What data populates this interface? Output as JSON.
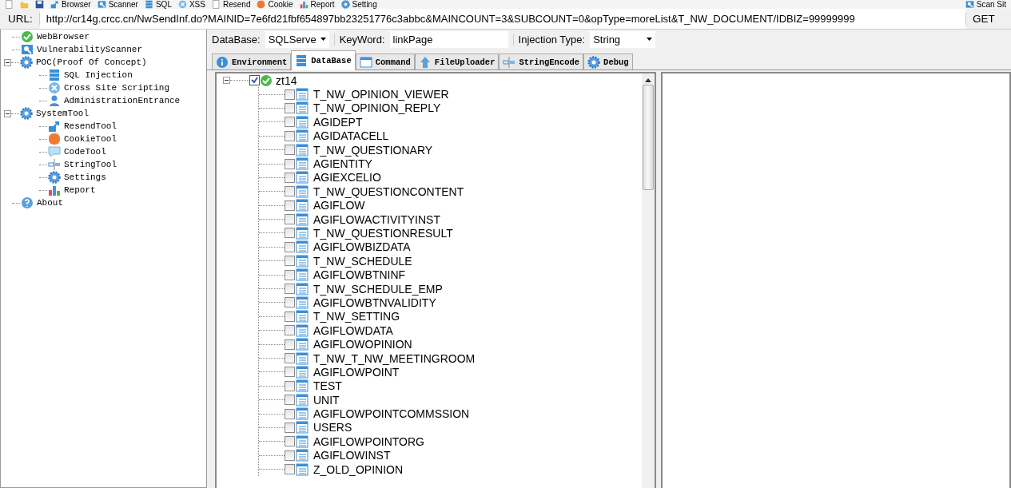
{
  "toolbar": {
    "items": [
      {
        "label": "Browser"
      },
      {
        "label": "Scanner"
      },
      {
        "label": "SQL"
      },
      {
        "label": "XSS"
      },
      {
        "label": "Resend"
      },
      {
        "label": "Cookie"
      },
      {
        "label": "Report"
      },
      {
        "label": "Setting"
      }
    ],
    "right_item": "Scan Sit"
  },
  "url_bar": {
    "label": "URL:",
    "value": "http://cr14g.crcc.cn/NwSendInf.do?MAINID=7e6fd21fbf654897bb23251776c3abbc&MAINCOUNT=3&SUBCOUNT=0&opType=moreList&T_NW_DOCUMENT/IDBIZ=99999999",
    "method": "GET"
  },
  "sidebar": {
    "items": [
      {
        "label": "WebBrowser"
      },
      {
        "label": "VulnerabilityScanner"
      },
      {
        "label": "POC(Proof Of Concept)",
        "expanded": true,
        "children": [
          {
            "label": "SQL Injection"
          },
          {
            "label": "Cross Site Scripting"
          },
          {
            "label": "AdministrationEntrance"
          }
        ]
      },
      {
        "label": "SystemTool",
        "expanded": true,
        "children": [
          {
            "label": "ResendTool"
          },
          {
            "label": "CookieTool"
          },
          {
            "label": "CodeTool"
          },
          {
            "label": "StringTool"
          },
          {
            "label": "Settings"
          },
          {
            "label": "Report"
          }
        ]
      },
      {
        "label": "About"
      }
    ]
  },
  "options": {
    "database_label": "DataBase:",
    "database": "SQLServe",
    "keyword_label": "KeyWord:",
    "keyword": "linkPage",
    "injection_label": "Injection Type:",
    "injection_type": "String"
  },
  "tabs": [
    {
      "label": "Environment",
      "selected": false
    },
    {
      "label": "DataBase",
      "selected": true
    },
    {
      "label": "Command",
      "selected": false
    },
    {
      "label": "FileUploader",
      "selected": false
    },
    {
      "label": "StringEncode",
      "selected": false
    },
    {
      "label": "Debug",
      "selected": false
    }
  ],
  "db_tree": {
    "label": "zt14",
    "checked": true,
    "expanded": true,
    "children": [
      {
        "label": "T_NW_OPINION_VIEWER",
        "checked": false
      },
      {
        "label": "T_NW_OPINION_REPLY",
        "checked": false
      },
      {
        "label": "AGIDEPT",
        "checked": false
      },
      {
        "label": "AGIDATACELL",
        "checked": false
      },
      {
        "label": "T_NW_QUESTIONARY",
        "checked": false
      },
      {
        "label": "AGIENTITY",
        "checked": false
      },
      {
        "label": "AGIEXCELIO",
        "checked": false
      },
      {
        "label": "T_NW_QUESTIONCONTENT",
        "checked": false
      },
      {
        "label": "AGIFLOW",
        "checked": false
      },
      {
        "label": "AGIFLOWACTIVITYINST",
        "checked": false
      },
      {
        "label": "T_NW_QUESTIONRESULT",
        "checked": false
      },
      {
        "label": "AGIFLOWBIZDATA",
        "checked": false
      },
      {
        "label": "T_NW_SCHEDULE",
        "checked": false
      },
      {
        "label": "AGIFLOWBTNINF",
        "checked": false
      },
      {
        "label": "T_NW_SCHEDULE_EMP",
        "checked": false
      },
      {
        "label": "AGIFLOWBTNVALIDITY",
        "checked": false
      },
      {
        "label": "T_NW_SETTING",
        "checked": false
      },
      {
        "label": "AGIFLOWDATA",
        "checked": false
      },
      {
        "label": "AGIFLOWOPINION",
        "checked": false
      },
      {
        "label": "T_NW_T_NW_MEETINGROOM",
        "checked": false
      },
      {
        "label": "AGIFLOWPOINT",
        "checked": false
      },
      {
        "label": "TEST",
        "checked": false
      },
      {
        "label": "UNIT",
        "checked": false
      },
      {
        "label": "AGIFLOWPOINTCOMMSSION",
        "checked": false
      },
      {
        "label": "USERS",
        "checked": false
      },
      {
        "label": "AGIFLOWPOINTORG",
        "checked": false
      },
      {
        "label": "AGIFLOWINST",
        "checked": false
      },
      {
        "label": "Z_OLD_OPINION",
        "checked": false
      }
    ]
  }
}
